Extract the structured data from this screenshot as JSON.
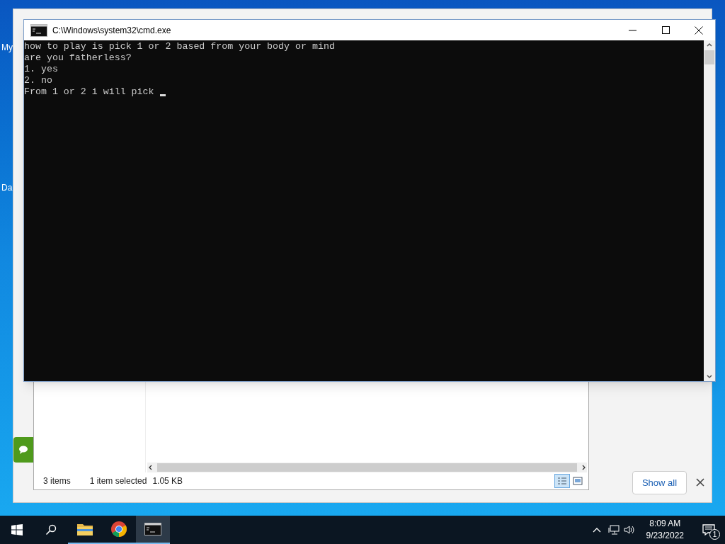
{
  "desktop_icons": [
    {
      "label": "My"
    },
    {
      "label": "Da"
    }
  ],
  "background_window": {
    "status_bar": {
      "item_count": "3 items",
      "selection": "1 item selected",
      "size": "1.05 KB"
    },
    "download_bar": {
      "button": "Show all"
    }
  },
  "console_window": {
    "title": "C:\\Windows\\system32\\cmd.exe",
    "lines": [
      "how to play is pick 1 or 2 based from your body or mind",
      "are you fatherless?",
      "1. yes",
      "2. no",
      "From 1 or 2 i will pick "
    ]
  },
  "taskbar": {
    "apps": [
      {
        "kind": "explorer",
        "selected": false
      },
      {
        "kind": "chrome",
        "selected": false
      },
      {
        "kind": "cmd",
        "selected": true
      }
    ],
    "time": "8:09 AM",
    "date": "9/23/2022",
    "notifications": "1"
  }
}
